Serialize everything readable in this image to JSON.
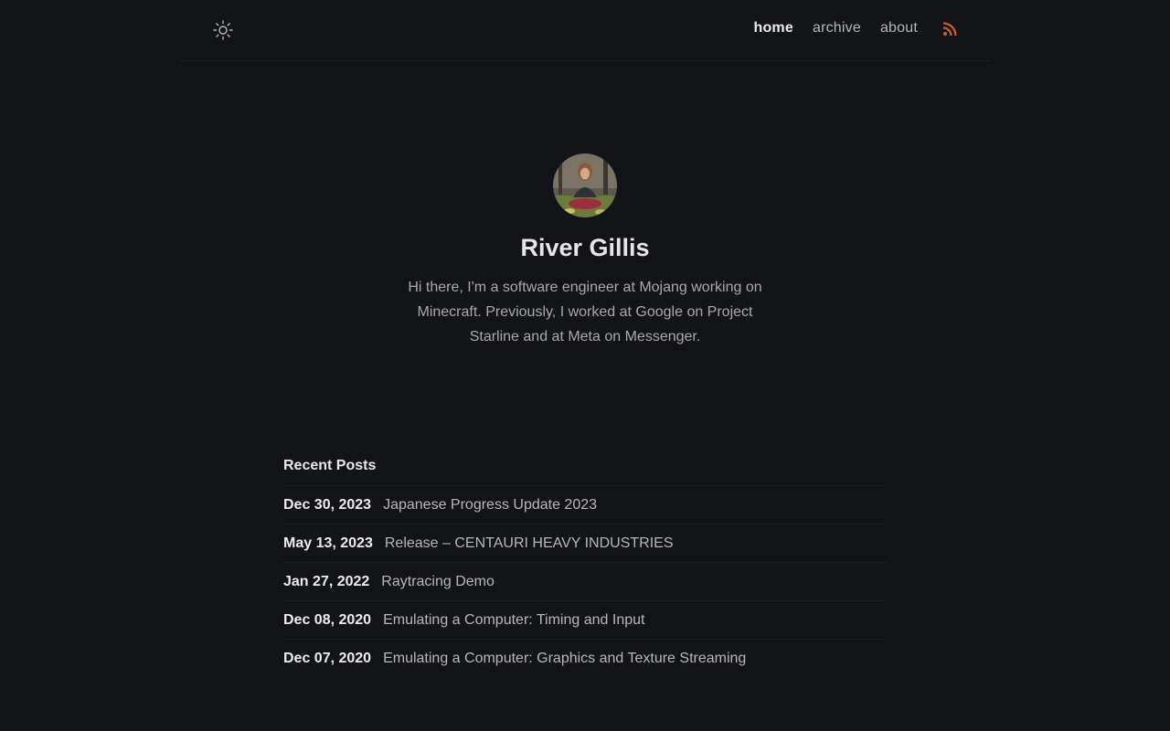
{
  "header": {
    "theme_icon": "sun-icon",
    "nav": [
      {
        "label": "home",
        "active": true
      },
      {
        "label": "archive",
        "active": false
      },
      {
        "label": "about",
        "active": false
      }
    ],
    "rss_icon": "rss-icon",
    "rss_color": "#c8632b"
  },
  "profile": {
    "name": "River Gillis",
    "bio": "Hi there, I'm a software engineer at Mojang working on Minecraft. Previously, I worked at Google on Project Starline and at Meta on Messenger."
  },
  "recent_posts": {
    "heading": "Recent Posts",
    "items": [
      {
        "date": "Dec 30, 2023",
        "title": "Japanese Progress Update 2023"
      },
      {
        "date": "May 13, 2023",
        "title": "Release – CENTAURI HEAVY INDUSTRIES"
      },
      {
        "date": "Jan 27, 2022",
        "title": "Raytracing Demo"
      },
      {
        "date": "Dec 08, 2020",
        "title": "Emulating a Computer: Timing and Input"
      },
      {
        "date": "Dec 07, 2020",
        "title": "Emulating a Computer: Graphics and Texture Streaming"
      }
    ]
  }
}
